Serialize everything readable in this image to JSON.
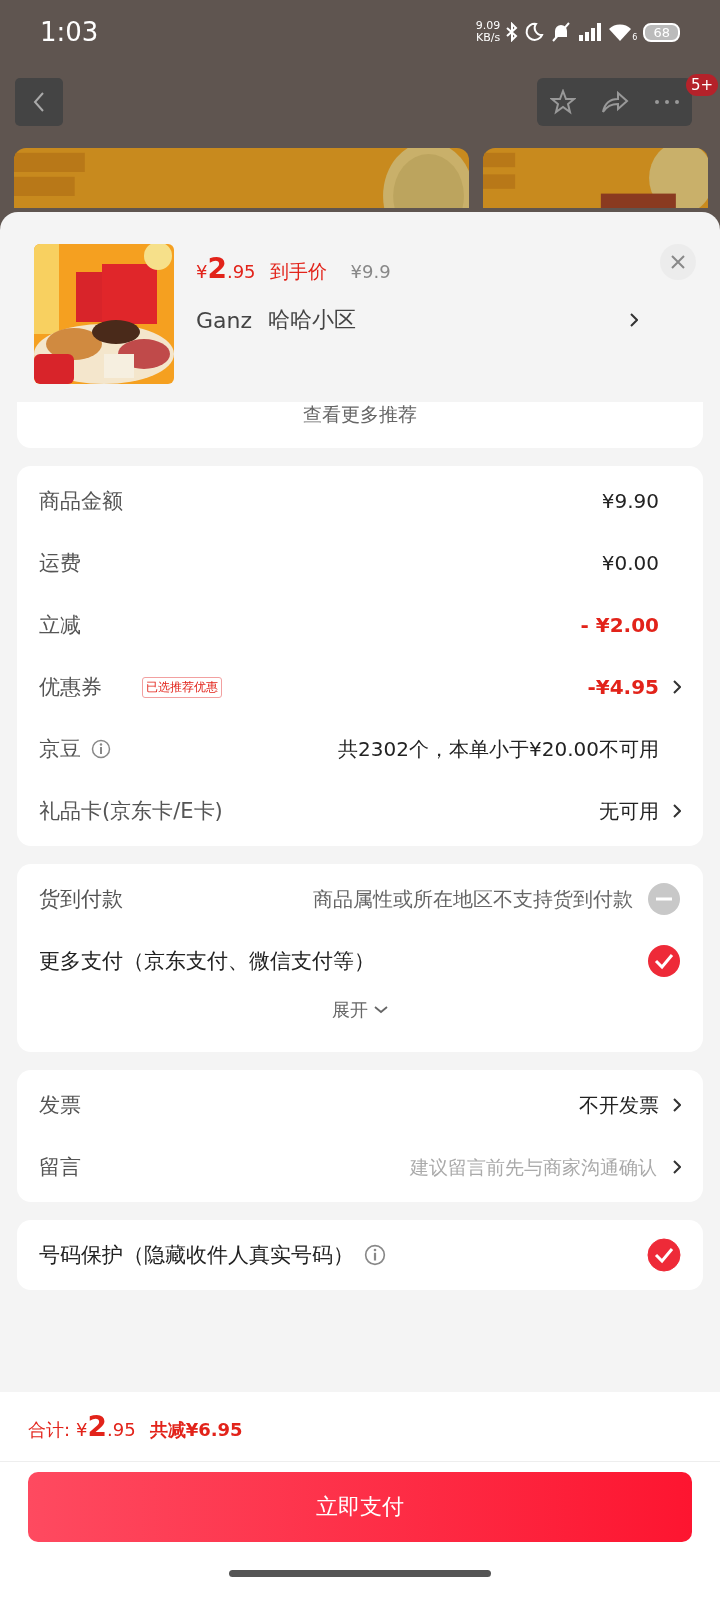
{
  "status_bar": {
    "time": "1:03",
    "net_speed": "9.09",
    "net_unit": "KB/s",
    "wifi_badge": "6",
    "battery": "68"
  },
  "nav": {
    "badge": "5+"
  },
  "product": {
    "price_symbol": "¥",
    "price_int": "2",
    "price_dec": ".95",
    "price_label": "到手价",
    "original_price": "¥9.9",
    "recipient": "Ganz",
    "address": "哈哈小区"
  },
  "more_recommend": "查看更多推荐",
  "price_rows": [
    {
      "label": "商品金额",
      "value": "¥9.90",
      "discount": false,
      "arrow": false,
      "info": false
    },
    {
      "label": "运费",
      "value": "¥0.00",
      "discount": false,
      "arrow": false,
      "info": false
    },
    {
      "label": "立减",
      "value": "- ¥2.00",
      "discount": true,
      "arrow": false,
      "info": false
    },
    {
      "label": "优惠券",
      "tag": "已选推荐优惠",
      "value": "-¥4.95",
      "discount": true,
      "arrow": true,
      "info": false
    },
    {
      "label": "京豆",
      "value": "共2302个，本单小于¥20.00不可用",
      "discount": false,
      "arrow": false,
      "info": true
    },
    {
      "label": "礼品卡(京东卡/E卡)",
      "value": "无可用",
      "discount": false,
      "arrow": true,
      "info": false
    }
  ],
  "payment": {
    "options": [
      {
        "label": "货到付款",
        "note": "商品属性或所在地区不支持货到付款",
        "disabled": true,
        "checked": false
      },
      {
        "label": "更多支付（京东支付、微信支付等）",
        "disabled": false,
        "checked": true
      }
    ],
    "expand": "展开"
  },
  "invoice_rows": [
    {
      "label": "发票",
      "value": "不开发票"
    },
    {
      "label": "留言",
      "placeholder": "建议留言前先与商家沟通确认"
    }
  ],
  "privacy": {
    "label": "号码保护（隐藏收件人真实号码）",
    "checked": true
  },
  "footer": {
    "total_label": "合计:",
    "symbol": "¥",
    "int": "2",
    "dec": ".95",
    "saved": "共减¥6.95",
    "pay_button": "立即支付"
  }
}
